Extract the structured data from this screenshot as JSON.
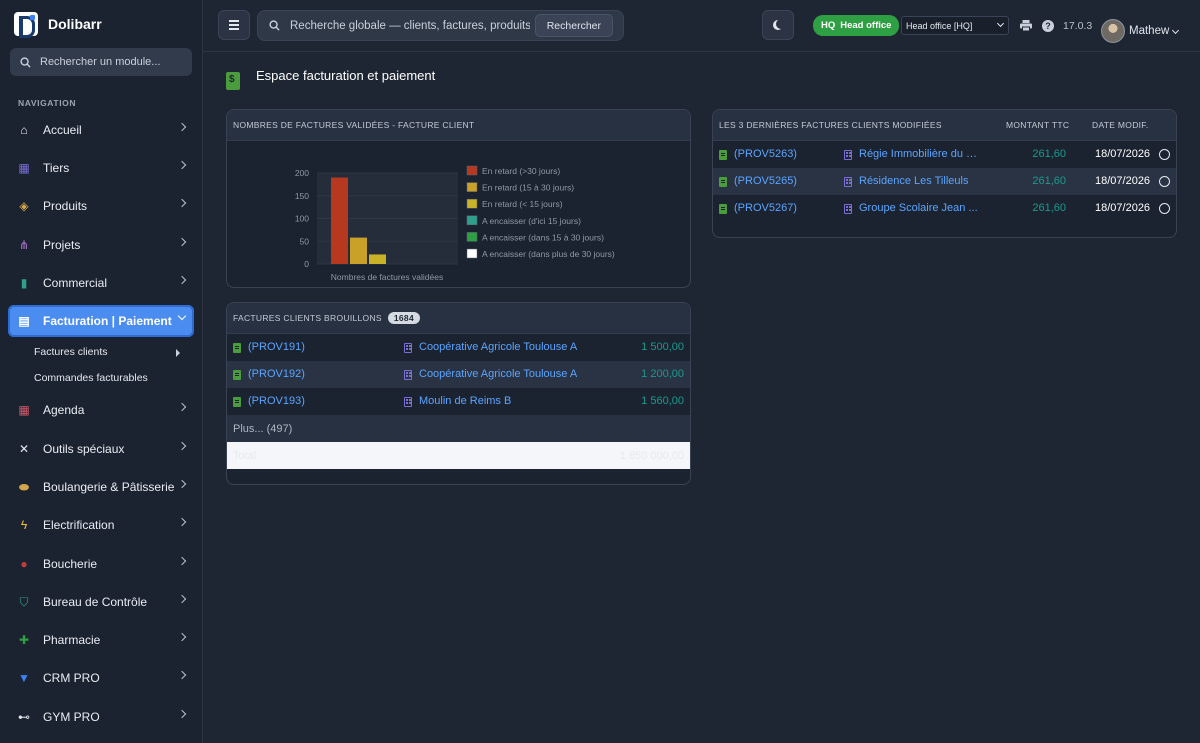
{
  "app": {
    "name": "Dolibarr"
  },
  "sidebar": {
    "module_search_placeholder": "Rechercher un module...",
    "nav_heading": "NAVIGATION",
    "items": [
      {
        "label": "Accueil",
        "icon": "home-icon",
        "color": "#e4e8ef"
      },
      {
        "label": "Tiers",
        "icon": "building-icon",
        "color": "#7b6fd6"
      },
      {
        "label": "Produits",
        "icon": "box-icon",
        "color": "#d4a64a"
      },
      {
        "label": "Projets",
        "icon": "project-icon",
        "color": "#b07ad6"
      },
      {
        "label": "Commercial",
        "icon": "briefcase-icon",
        "color": "#2ea08c"
      },
      {
        "label": "Facturation | Paiement",
        "icon": "invoice-icon",
        "color": "#4b9c3d"
      },
      {
        "label": "Agenda",
        "icon": "calendar-icon",
        "color": "#d45a6a"
      },
      {
        "label": "Outils spéciaux",
        "icon": "tools-icon",
        "color": "#e4e8ef"
      },
      {
        "label": "Boulangerie & Pâtisserie",
        "icon": "bread-icon",
        "color": "#d4a64a"
      },
      {
        "label": "Electrification",
        "icon": "bolt-icon",
        "color": "#f2c230"
      },
      {
        "label": "Boucherie",
        "icon": "meat-icon",
        "color": "#c43c3c"
      },
      {
        "label": "Bureau de Contrôle",
        "icon": "shield-icon",
        "color": "#2ea08c"
      },
      {
        "label": "Pharmacie",
        "icon": "cross-icon",
        "color": "#2ea043"
      },
      {
        "label": "CRM PRO",
        "icon": "funnel-icon",
        "color": "#3b82f6"
      },
      {
        "label": "GYM PRO",
        "icon": "dumbbell-icon",
        "color": "#e4e8ef"
      }
    ],
    "sub_items": [
      {
        "label": "Factures clients"
      },
      {
        "label": "Commandes facturables"
      }
    ]
  },
  "topbar": {
    "search_placeholder": "Recherche globale — clients, factures, produits...",
    "search_button": "Rechercher",
    "hq_code": "HQ",
    "hq_label": "Head office",
    "entity_selected": "Head office [HQ]",
    "version": "17.0.3",
    "user": "Mathew"
  },
  "page": {
    "title": "Espace facturation et paiement"
  },
  "chart_box": {
    "title": "NOMBRES DE FACTURES VALIDÉES - FACTURE CLIENT"
  },
  "chart_data": {
    "type": "bar",
    "xlabel": "Nombres de factures validées",
    "ylim": [
      0,
      200
    ],
    "yticks": [
      0,
      50,
      100,
      150,
      200
    ],
    "series": [
      {
        "name": "En retard (>30 jours)",
        "value": 190,
        "color": "#b5381f"
      },
      {
        "name": "En retard (15 à 30 jours)",
        "value": 58,
        "color": "#c9a028"
      },
      {
        "name": "En retard (< 15 jours)",
        "value": 21,
        "color": "#c9b228"
      },
      {
        "name": "A encaisser (d'ici 15 jours)",
        "value": 0,
        "color": "#2ea08c"
      },
      {
        "name": "A encaisser (dans 15 à 30 jours)",
        "value": 0,
        "color": "#2ea043"
      },
      {
        "name": "A encaisser (dans plus de 30 jours)",
        "value": 0,
        "color": "#ffffff"
      }
    ],
    "legend": "right"
  },
  "last_invoices": {
    "title": "LES 3 DERNIÈRES FACTURES CLIENTS MODIFIÉES",
    "col_amount": "MONTANT TTC",
    "col_date": "DATE MODIF.",
    "rows": [
      {
        "ref": "(PROV5263)",
        "company": "Régie Immobilière du P...",
        "amount": "261,60",
        "date": "18/07/2026"
      },
      {
        "ref": "(PROV5265)",
        "company": "Résidence Les Tilleuls",
        "amount": "261,60",
        "date": "18/07/2026"
      },
      {
        "ref": "(PROV5267)",
        "company": "Groupe Scolaire Jean ...",
        "amount": "261,60",
        "date": "18/07/2026"
      }
    ]
  },
  "drafts": {
    "title": "FACTURES CLIENTS BROUILLONS",
    "count": "1684",
    "rows": [
      {
        "ref": "(PROV191)",
        "company": "Coopérative Agricole Toulouse A",
        "amount": "1 500,00"
      },
      {
        "ref": "(PROV192)",
        "company": "Coopérative Agricole Toulouse A",
        "amount": "1 200,00"
      },
      {
        "ref": "(PROV193)",
        "company": "Moulin de Reims B",
        "amount": "1 560,00"
      }
    ],
    "more": "Plus... (497)",
    "total_label": "Total",
    "total_amount": "1 850 000,00"
  }
}
